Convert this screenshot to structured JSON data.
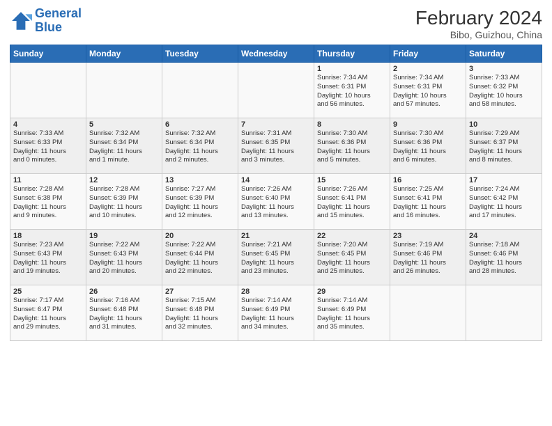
{
  "header": {
    "logo_line1": "General",
    "logo_line2": "Blue",
    "title": "February 2024",
    "subtitle": "Bibo, Guizhou, China"
  },
  "weekdays": [
    "Sunday",
    "Monday",
    "Tuesday",
    "Wednesday",
    "Thursday",
    "Friday",
    "Saturday"
  ],
  "weeks": [
    [
      {
        "day": "",
        "info": ""
      },
      {
        "day": "",
        "info": ""
      },
      {
        "day": "",
        "info": ""
      },
      {
        "day": "",
        "info": ""
      },
      {
        "day": "1",
        "info": "Sunrise: 7:34 AM\nSunset: 6:31 PM\nDaylight: 10 hours\nand 56 minutes."
      },
      {
        "day": "2",
        "info": "Sunrise: 7:34 AM\nSunset: 6:31 PM\nDaylight: 10 hours\nand 57 minutes."
      },
      {
        "day": "3",
        "info": "Sunrise: 7:33 AM\nSunset: 6:32 PM\nDaylight: 10 hours\nand 58 minutes."
      }
    ],
    [
      {
        "day": "4",
        "info": "Sunrise: 7:33 AM\nSunset: 6:33 PM\nDaylight: 11 hours\nand 0 minutes."
      },
      {
        "day": "5",
        "info": "Sunrise: 7:32 AM\nSunset: 6:34 PM\nDaylight: 11 hours\nand 1 minute."
      },
      {
        "day": "6",
        "info": "Sunrise: 7:32 AM\nSunset: 6:34 PM\nDaylight: 11 hours\nand 2 minutes."
      },
      {
        "day": "7",
        "info": "Sunrise: 7:31 AM\nSunset: 6:35 PM\nDaylight: 11 hours\nand 3 minutes."
      },
      {
        "day": "8",
        "info": "Sunrise: 7:30 AM\nSunset: 6:36 PM\nDaylight: 11 hours\nand 5 minutes."
      },
      {
        "day": "9",
        "info": "Sunrise: 7:30 AM\nSunset: 6:36 PM\nDaylight: 11 hours\nand 6 minutes."
      },
      {
        "day": "10",
        "info": "Sunrise: 7:29 AM\nSunset: 6:37 PM\nDaylight: 11 hours\nand 8 minutes."
      }
    ],
    [
      {
        "day": "11",
        "info": "Sunrise: 7:28 AM\nSunset: 6:38 PM\nDaylight: 11 hours\nand 9 minutes."
      },
      {
        "day": "12",
        "info": "Sunrise: 7:28 AM\nSunset: 6:39 PM\nDaylight: 11 hours\nand 10 minutes."
      },
      {
        "day": "13",
        "info": "Sunrise: 7:27 AM\nSunset: 6:39 PM\nDaylight: 11 hours\nand 12 minutes."
      },
      {
        "day": "14",
        "info": "Sunrise: 7:26 AM\nSunset: 6:40 PM\nDaylight: 11 hours\nand 13 minutes."
      },
      {
        "day": "15",
        "info": "Sunrise: 7:26 AM\nSunset: 6:41 PM\nDaylight: 11 hours\nand 15 minutes."
      },
      {
        "day": "16",
        "info": "Sunrise: 7:25 AM\nSunset: 6:41 PM\nDaylight: 11 hours\nand 16 minutes."
      },
      {
        "day": "17",
        "info": "Sunrise: 7:24 AM\nSunset: 6:42 PM\nDaylight: 11 hours\nand 17 minutes."
      }
    ],
    [
      {
        "day": "18",
        "info": "Sunrise: 7:23 AM\nSunset: 6:43 PM\nDaylight: 11 hours\nand 19 minutes."
      },
      {
        "day": "19",
        "info": "Sunrise: 7:22 AM\nSunset: 6:43 PM\nDaylight: 11 hours\nand 20 minutes."
      },
      {
        "day": "20",
        "info": "Sunrise: 7:22 AM\nSunset: 6:44 PM\nDaylight: 11 hours\nand 22 minutes."
      },
      {
        "day": "21",
        "info": "Sunrise: 7:21 AM\nSunset: 6:45 PM\nDaylight: 11 hours\nand 23 minutes."
      },
      {
        "day": "22",
        "info": "Sunrise: 7:20 AM\nSunset: 6:45 PM\nDaylight: 11 hours\nand 25 minutes."
      },
      {
        "day": "23",
        "info": "Sunrise: 7:19 AM\nSunset: 6:46 PM\nDaylight: 11 hours\nand 26 minutes."
      },
      {
        "day": "24",
        "info": "Sunrise: 7:18 AM\nSunset: 6:46 PM\nDaylight: 11 hours\nand 28 minutes."
      }
    ],
    [
      {
        "day": "25",
        "info": "Sunrise: 7:17 AM\nSunset: 6:47 PM\nDaylight: 11 hours\nand 29 minutes."
      },
      {
        "day": "26",
        "info": "Sunrise: 7:16 AM\nSunset: 6:48 PM\nDaylight: 11 hours\nand 31 minutes."
      },
      {
        "day": "27",
        "info": "Sunrise: 7:15 AM\nSunset: 6:48 PM\nDaylight: 11 hours\nand 32 minutes."
      },
      {
        "day": "28",
        "info": "Sunrise: 7:14 AM\nSunset: 6:49 PM\nDaylight: 11 hours\nand 34 minutes."
      },
      {
        "day": "29",
        "info": "Sunrise: 7:14 AM\nSunset: 6:49 PM\nDaylight: 11 hours\nand 35 minutes."
      },
      {
        "day": "",
        "info": ""
      },
      {
        "day": "",
        "info": ""
      }
    ]
  ]
}
